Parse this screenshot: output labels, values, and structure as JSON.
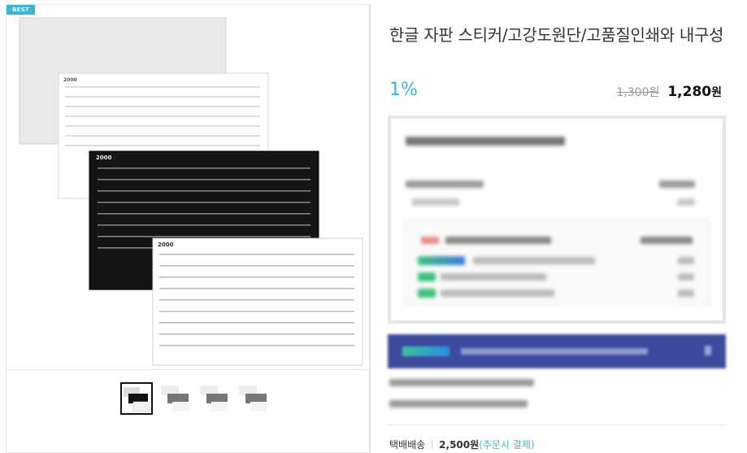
{
  "badge": "BEST",
  "product": {
    "title": "한글 자판 스티커/고강도원단/고품질인쇄와 내구성",
    "discount": "1%",
    "old_price": "1,300원",
    "new_price": "1,280",
    "currency": "원"
  },
  "shipping": {
    "label": "택배배송",
    "fee": "2,500원",
    "note": "(주문시 결제)"
  },
  "thumbnails": [
    "thumb-1",
    "thumb-2",
    "thumb-3",
    "thumb-4"
  ],
  "colors": {
    "accent": "#3fb4cf",
    "promo_bar": "#3d4a9e"
  },
  "icons": {
    "promo_arrow": "chevron-right-icon"
  }
}
